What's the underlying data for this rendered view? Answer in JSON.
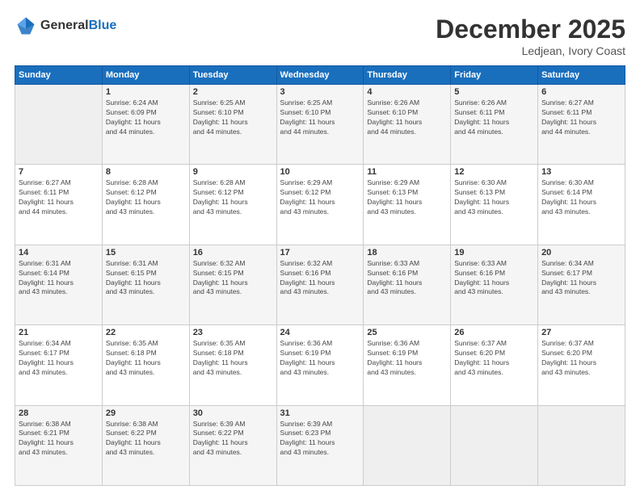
{
  "logo": {
    "general": "General",
    "blue": "Blue"
  },
  "title": "December 2025",
  "location": "Ledjean, Ivory Coast",
  "headers": [
    "Sunday",
    "Monday",
    "Tuesday",
    "Wednesday",
    "Thursday",
    "Friday",
    "Saturday"
  ],
  "weeks": [
    [
      {
        "day": "",
        "info": ""
      },
      {
        "day": "1",
        "info": "Sunrise: 6:24 AM\nSunset: 6:09 PM\nDaylight: 11 hours\nand 44 minutes."
      },
      {
        "day": "2",
        "info": "Sunrise: 6:25 AM\nSunset: 6:10 PM\nDaylight: 11 hours\nand 44 minutes."
      },
      {
        "day": "3",
        "info": "Sunrise: 6:25 AM\nSunset: 6:10 PM\nDaylight: 11 hours\nand 44 minutes."
      },
      {
        "day": "4",
        "info": "Sunrise: 6:26 AM\nSunset: 6:10 PM\nDaylight: 11 hours\nand 44 minutes."
      },
      {
        "day": "5",
        "info": "Sunrise: 6:26 AM\nSunset: 6:11 PM\nDaylight: 11 hours\nand 44 minutes."
      },
      {
        "day": "6",
        "info": "Sunrise: 6:27 AM\nSunset: 6:11 PM\nDaylight: 11 hours\nand 44 minutes."
      }
    ],
    [
      {
        "day": "7",
        "info": "Sunrise: 6:27 AM\nSunset: 6:11 PM\nDaylight: 11 hours\nand 44 minutes."
      },
      {
        "day": "8",
        "info": "Sunrise: 6:28 AM\nSunset: 6:12 PM\nDaylight: 11 hours\nand 43 minutes."
      },
      {
        "day": "9",
        "info": "Sunrise: 6:28 AM\nSunset: 6:12 PM\nDaylight: 11 hours\nand 43 minutes."
      },
      {
        "day": "10",
        "info": "Sunrise: 6:29 AM\nSunset: 6:12 PM\nDaylight: 11 hours\nand 43 minutes."
      },
      {
        "day": "11",
        "info": "Sunrise: 6:29 AM\nSunset: 6:13 PM\nDaylight: 11 hours\nand 43 minutes."
      },
      {
        "day": "12",
        "info": "Sunrise: 6:30 AM\nSunset: 6:13 PM\nDaylight: 11 hours\nand 43 minutes."
      },
      {
        "day": "13",
        "info": "Sunrise: 6:30 AM\nSunset: 6:14 PM\nDaylight: 11 hours\nand 43 minutes."
      }
    ],
    [
      {
        "day": "14",
        "info": "Sunrise: 6:31 AM\nSunset: 6:14 PM\nDaylight: 11 hours\nand 43 minutes."
      },
      {
        "day": "15",
        "info": "Sunrise: 6:31 AM\nSunset: 6:15 PM\nDaylight: 11 hours\nand 43 minutes."
      },
      {
        "day": "16",
        "info": "Sunrise: 6:32 AM\nSunset: 6:15 PM\nDaylight: 11 hours\nand 43 minutes."
      },
      {
        "day": "17",
        "info": "Sunrise: 6:32 AM\nSunset: 6:16 PM\nDaylight: 11 hours\nand 43 minutes."
      },
      {
        "day": "18",
        "info": "Sunrise: 6:33 AM\nSunset: 6:16 PM\nDaylight: 11 hours\nand 43 minutes."
      },
      {
        "day": "19",
        "info": "Sunrise: 6:33 AM\nSunset: 6:16 PM\nDaylight: 11 hours\nand 43 minutes."
      },
      {
        "day": "20",
        "info": "Sunrise: 6:34 AM\nSunset: 6:17 PM\nDaylight: 11 hours\nand 43 minutes."
      }
    ],
    [
      {
        "day": "21",
        "info": "Sunrise: 6:34 AM\nSunset: 6:17 PM\nDaylight: 11 hours\nand 43 minutes."
      },
      {
        "day": "22",
        "info": "Sunrise: 6:35 AM\nSunset: 6:18 PM\nDaylight: 11 hours\nand 43 minutes."
      },
      {
        "day": "23",
        "info": "Sunrise: 6:35 AM\nSunset: 6:18 PM\nDaylight: 11 hours\nand 43 minutes."
      },
      {
        "day": "24",
        "info": "Sunrise: 6:36 AM\nSunset: 6:19 PM\nDaylight: 11 hours\nand 43 minutes."
      },
      {
        "day": "25",
        "info": "Sunrise: 6:36 AM\nSunset: 6:19 PM\nDaylight: 11 hours\nand 43 minutes."
      },
      {
        "day": "26",
        "info": "Sunrise: 6:37 AM\nSunset: 6:20 PM\nDaylight: 11 hours\nand 43 minutes."
      },
      {
        "day": "27",
        "info": "Sunrise: 6:37 AM\nSunset: 6:20 PM\nDaylight: 11 hours\nand 43 minutes."
      }
    ],
    [
      {
        "day": "28",
        "info": "Sunrise: 6:38 AM\nSunset: 6:21 PM\nDaylight: 11 hours\nand 43 minutes."
      },
      {
        "day": "29",
        "info": "Sunrise: 6:38 AM\nSunset: 6:22 PM\nDaylight: 11 hours\nand 43 minutes."
      },
      {
        "day": "30",
        "info": "Sunrise: 6:39 AM\nSunset: 6:22 PM\nDaylight: 11 hours\nand 43 minutes."
      },
      {
        "day": "31",
        "info": "Sunrise: 6:39 AM\nSunset: 6:23 PM\nDaylight: 11 hours\nand 43 minutes."
      },
      {
        "day": "",
        "info": ""
      },
      {
        "day": "",
        "info": ""
      },
      {
        "day": "",
        "info": ""
      }
    ]
  ]
}
